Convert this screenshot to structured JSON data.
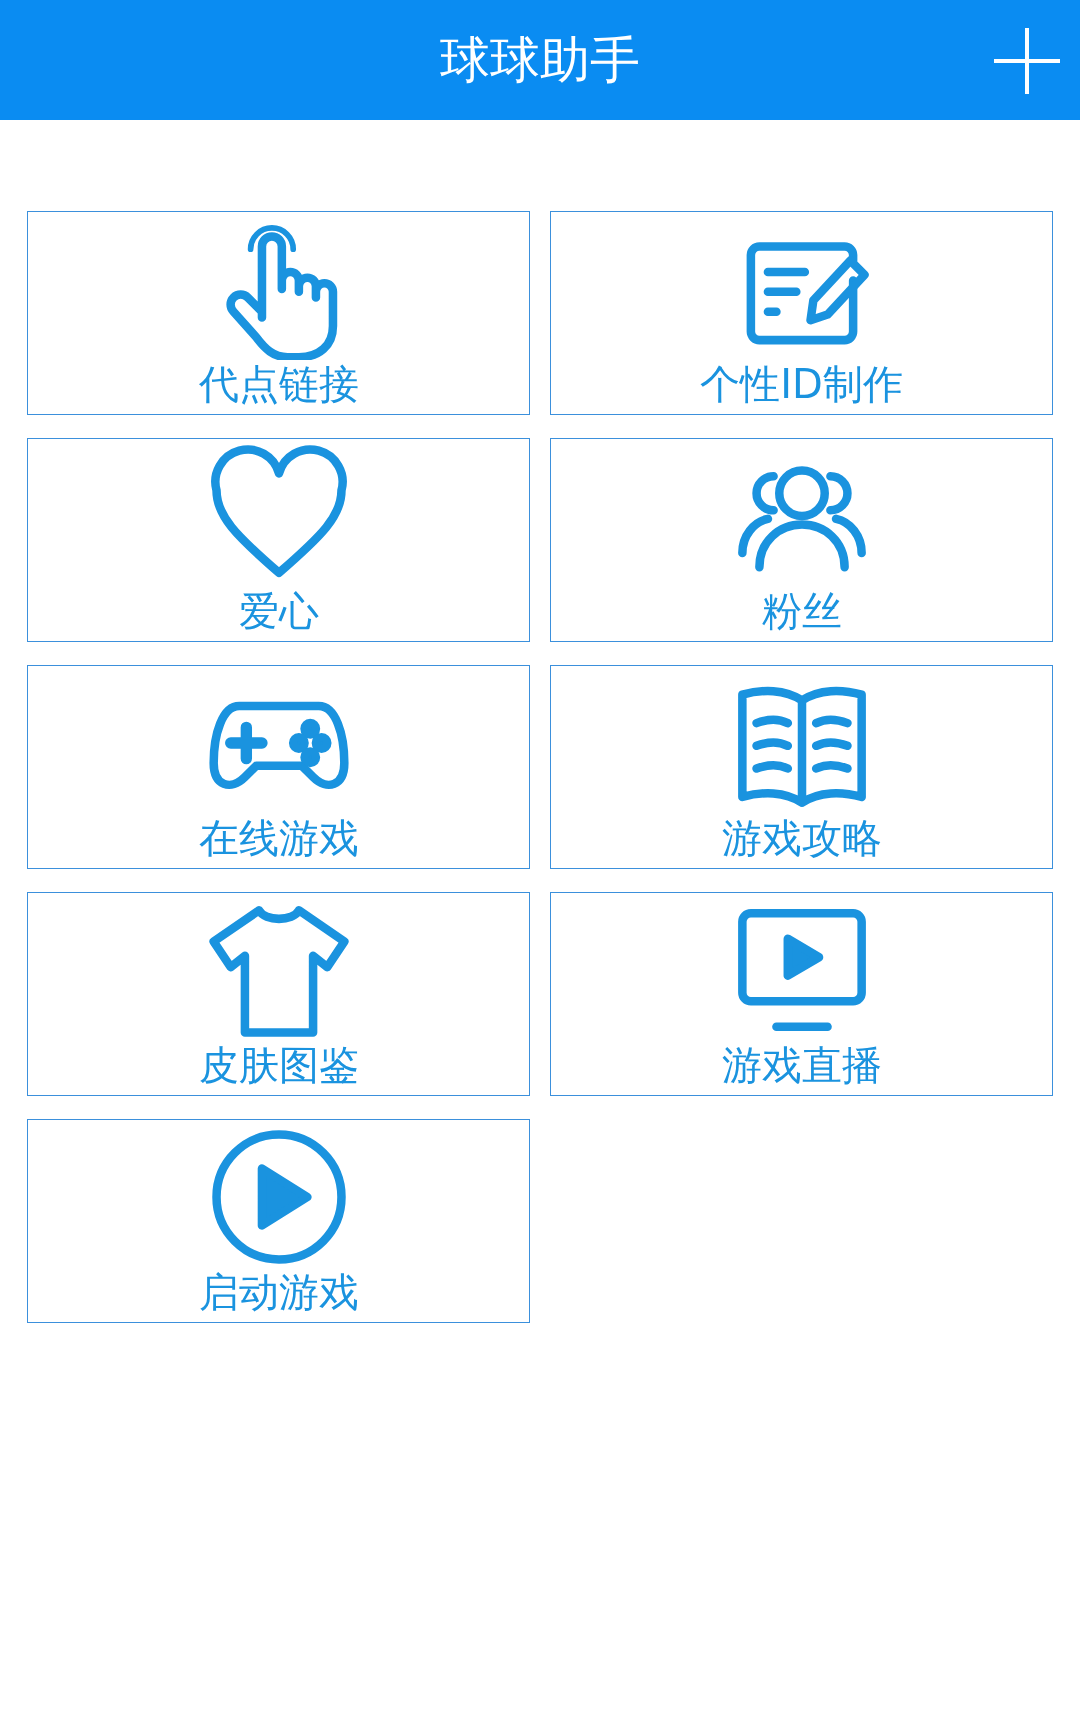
{
  "header": {
    "title": "球球助手"
  },
  "tiles": [
    {
      "label": "代点链接"
    },
    {
      "label": "个性ID制作"
    },
    {
      "label": "爱心"
    },
    {
      "label": "粉丝"
    },
    {
      "label": "在线游戏"
    },
    {
      "label": "游戏攻略"
    },
    {
      "label": "皮肤图鉴"
    },
    {
      "label": "游戏直播"
    },
    {
      "label": "启动游戏"
    }
  ]
}
